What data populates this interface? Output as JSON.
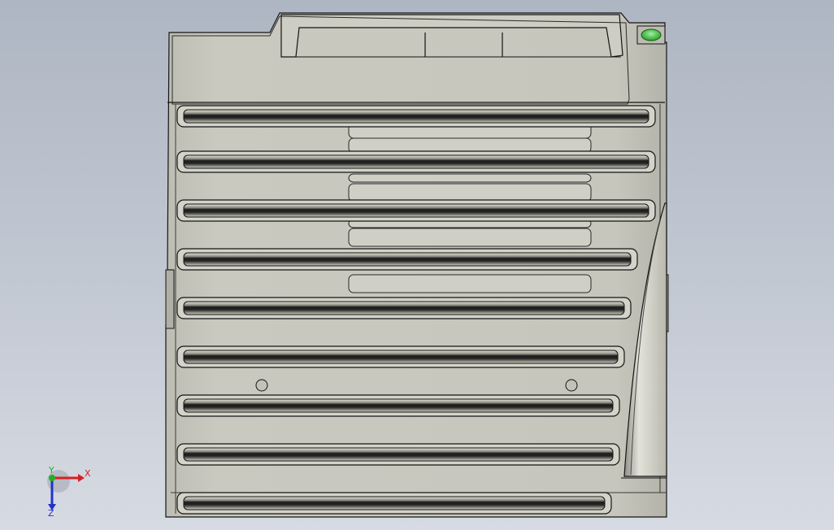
{
  "app": {
    "type": "cad-viewport"
  },
  "model": {
    "name": "",
    "view": "front",
    "body_color": "#c7c7bd",
    "edge_color": "#141414",
    "slot_color": "#2c2c2c",
    "led_color": "#3fbf3f",
    "fin_count": 9,
    "mounting_hole_count": 2
  },
  "triad": {
    "x_label": "X",
    "y_label": "Y",
    "z_label": "Z",
    "x_color": "#d82020",
    "y_color": "#22b022",
    "z_color": "#2034c8"
  }
}
